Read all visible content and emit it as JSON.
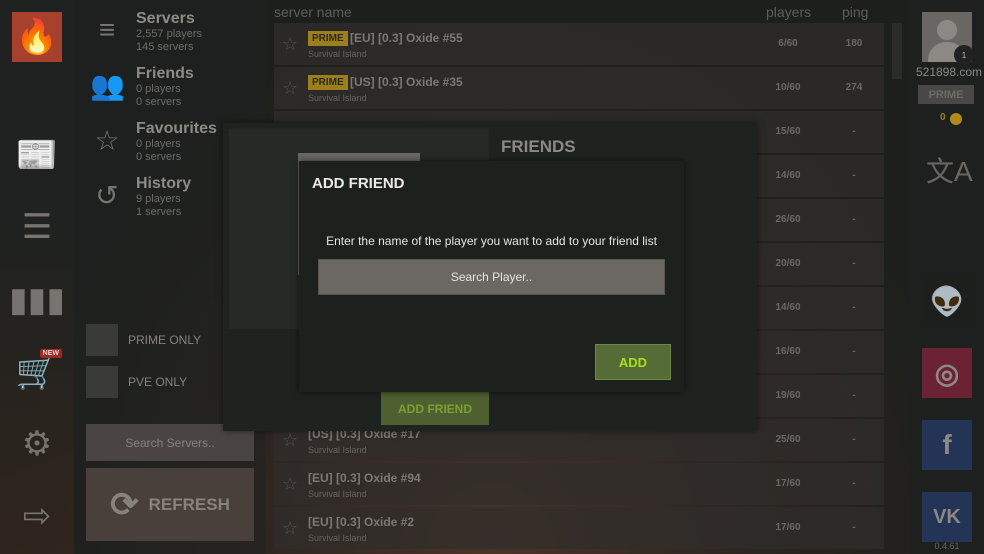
{
  "sidebar": {
    "nav": [
      {
        "label": "Servers",
        "players": "2,557 players",
        "servers": "145 servers",
        "icon": "server-stack-icon"
      },
      {
        "label": "Friends",
        "players": "0 players",
        "servers": "0 servers",
        "icon": "friends-icon"
      },
      {
        "label": "Favourites",
        "players": "0 players",
        "servers": "0 servers",
        "icon": "star-icon"
      },
      {
        "label": "History",
        "players": "9 players",
        "servers": "1 servers",
        "icon": "history-icon"
      }
    ],
    "filters": {
      "prime_only": "PRIME ONLY",
      "pve_only": "PVE ONLY"
    },
    "search_placeholder": "Search Servers..",
    "refresh": "REFRESH",
    "new_badge": "NEW"
  },
  "table": {
    "headers": {
      "name": "server name",
      "players": "players",
      "ping": "ping"
    },
    "prime_badge": "PRIME",
    "rows": [
      {
        "prime": true,
        "name": "[EU] [0.3] Oxide #55",
        "map": "Survival Island",
        "players": "6/60",
        "ping": "180"
      },
      {
        "prime": true,
        "name": "[US] [0.3] Oxide #35",
        "map": "Survival Island",
        "players": "10/60",
        "ping": "274"
      },
      {
        "prime": false,
        "name": "",
        "map": "",
        "players": "15/60",
        "ping": "-"
      },
      {
        "prime": false,
        "name": "",
        "map": "",
        "players": "14/60",
        "ping": "-"
      },
      {
        "prime": false,
        "name": "",
        "map": "",
        "players": "26/60",
        "ping": "-"
      },
      {
        "prime": false,
        "name": "",
        "map": "",
        "players": "20/60",
        "ping": "-"
      },
      {
        "prime": false,
        "name": "",
        "map": "",
        "players": "14/60",
        "ping": "-"
      },
      {
        "prime": false,
        "name": "",
        "map": "",
        "players": "16/60",
        "ping": "-"
      },
      {
        "prime": false,
        "name": "",
        "map": "",
        "players": "19/60",
        "ping": "-"
      },
      {
        "prime": false,
        "name": "[US] [0.3] Oxide #17",
        "map": "Survival Island",
        "players": "25/60",
        "ping": "-"
      },
      {
        "prime": false,
        "name": "[EU] [0.3] Oxide #94",
        "map": "Survival Island",
        "players": "17/60",
        "ping": "-"
      },
      {
        "prime": false,
        "name": "[EU] [0.3] Oxide #2",
        "map": "Survival Island",
        "players": "17/60",
        "ping": "-"
      }
    ]
  },
  "profile": {
    "username": "521898.com",
    "notifications": "1",
    "status": "PRIME",
    "coins": "0",
    "version": "0.4.61"
  },
  "friends_panel": {
    "title": "FRIENDS",
    "add_friend": "ADD FRIEND"
  },
  "dialog": {
    "title": "ADD FRIEND",
    "message": "Enter the name of the player you want to add to your friend list",
    "placeholder": "Search Player..",
    "value": "",
    "add": "ADD"
  },
  "colors": {
    "accent_green": "#a6e01a",
    "prime_gold": "#9a7f1c",
    "logo_red": "#a8402e",
    "instagram": "#6b2234",
    "facebook": "#233456"
  }
}
